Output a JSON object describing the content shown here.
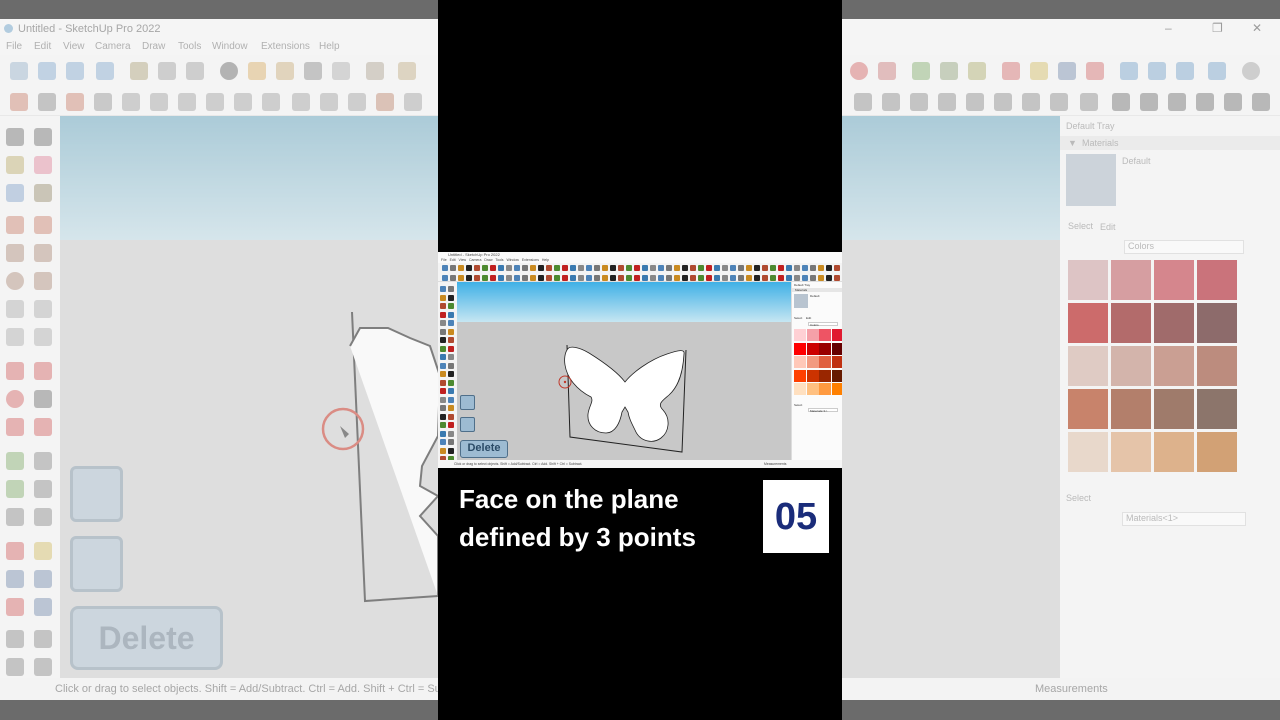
{
  "window": {
    "title": "Untitled - SketchUp Pro 2022",
    "controls": [
      "–",
      "❐",
      "✕"
    ]
  },
  "menu": [
    "File",
    "Edit",
    "View",
    "Camera",
    "Draw",
    "Tools",
    "Window",
    "Extensions",
    "Help"
  ],
  "status": {
    "message": "Click or drag to select objects. Shift = Add/Subtract. Ctrl = Add. Shift + Ctrl = Subtract.",
    "message_visible": "Click or drag to select objects. Shift = Add/Subtract. Ctrl = Add. Shift + Ctrl = Subtra",
    "measurements_label": "Measurements"
  },
  "tray": {
    "title": "Default Tray",
    "panel": "Materials",
    "material_name": "Default",
    "tabs": [
      "Select",
      "Edit"
    ],
    "library": "Colors",
    "select_section": "Select",
    "model_library": "Materials<1>"
  },
  "keys": {
    "delete_label": "Delete"
  },
  "caption": {
    "line1": "Face on the plane",
    "line2": "defined by 3 points",
    "episode": "05"
  },
  "colors": {
    "swatches_bg": [
      "#c49a9c",
      "#b8585e",
      "#b72f3b",
      "#a40f1d",
      "#a80000",
      "#7c0000",
      "#5c0000",
      "#3c0000",
      "#c8a69a",
      "#b47e6e",
      "#a45a46",
      "#8c3a22",
      "#a02a00",
      "#7c2300",
      "#5a1c00",
      "#3a1200",
      "#d8bca6",
      "#d29a6c",
      "#c47a3a",
      "#b25e12"
    ],
    "swatches_mini": [
      "#ffd0d4",
      "#f5a0a8",
      "#ee5464",
      "#e01a30",
      "#ff0000",
      "#cc0000",
      "#990000",
      "#660000",
      "#ffc8b8",
      "#f29a80",
      "#e06040",
      "#c03010",
      "#ff4000",
      "#cc3300",
      "#992600",
      "#661a00",
      "#ffe0c0",
      "#ffc080",
      "#ff9a40",
      "#ff8000"
    ],
    "caption_bg": "#000000",
    "badge_text": "#1a2c7a"
  }
}
